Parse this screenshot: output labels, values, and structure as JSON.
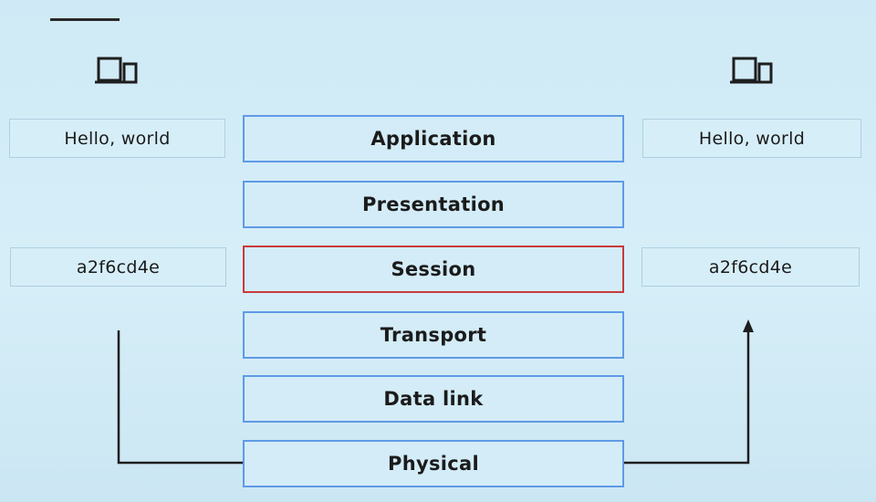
{
  "layers": [
    {
      "label": "Application"
    },
    {
      "label": "Presentation"
    },
    {
      "label": "Session"
    },
    {
      "label": "Transport"
    },
    {
      "label": "Data link"
    },
    {
      "label": "Physical"
    }
  ],
  "highlighted_layer": "Session",
  "sender": {
    "icon": "laptop-icon",
    "message": "Hello, world",
    "encoded": "a2f6cd4e"
  },
  "receiver": {
    "icon": "laptop-icon",
    "message": "Hello, world",
    "encoded": "a2f6cd4e"
  },
  "colors": {
    "layer_border": "#5f9ae6",
    "highlight_border": "#c9393c",
    "background": "#d3ecf7",
    "wire": "#1e1e1e"
  }
}
